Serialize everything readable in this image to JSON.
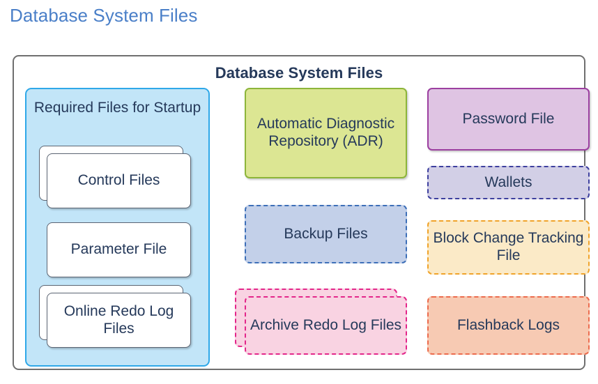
{
  "page": {
    "heading": "Database System Files",
    "heading_color": "#4a7fc8"
  },
  "diagram": {
    "title": "Database System Files",
    "title_color": "#25395a",
    "border_color": "#6f6f6f",
    "background": "#ffffff",
    "groups": [
      {
        "id": "required-files-for-startup",
        "label": "Required Files for Startup",
        "fill": "#c2e5f8",
        "border": "#2fa8e8",
        "border_style": "solid",
        "items": [
          {
            "id": "control-files",
            "label": "Control Files",
            "fill": "#ffffff",
            "border": "#5b6472",
            "border_style": "solid",
            "stacked": true
          },
          {
            "id": "parameter-file",
            "label": "Parameter File",
            "fill": "#ffffff",
            "border": "#5b6472",
            "border_style": "solid",
            "stacked": false
          },
          {
            "id": "online-redo-log-files",
            "label": "Online Redo Log Files",
            "fill": "#ffffff",
            "border": "#5b6472",
            "border_style": "solid",
            "stacked": true
          }
        ]
      }
    ],
    "middle_column": [
      {
        "id": "adr",
        "label": "Automatic Diagnostic Repository (ADR)",
        "fill": "#dce693",
        "border": "#8db53a",
        "border_style": "solid",
        "stacked": false
      },
      {
        "id": "backup-files",
        "label": "Backup Files",
        "fill": "#c3d0e9",
        "border": "#3d6fb8",
        "border_style": "dashed",
        "stacked": false
      },
      {
        "id": "archive-redo-log-files",
        "label": "Archive Redo Log Files",
        "fill": "#f9d3e2",
        "border": "#e3268a",
        "border_style": "dashed",
        "stacked": true
      }
    ],
    "right_column": [
      {
        "id": "password-file",
        "label": "Password File",
        "fill": "#dfc4e3",
        "border": "#9c3fa0",
        "border_style": "solid",
        "stacked": false
      },
      {
        "id": "wallets",
        "label": "Wallets",
        "fill": "#d2cfe6",
        "border": "#3d3f9e",
        "border_style": "dashed",
        "stacked": false
      },
      {
        "id": "block-change-tracking-file",
        "label": "Block Change Tracking File",
        "fill": "#fbeac7",
        "border": "#f0a32a",
        "border_style": "dashed",
        "stacked": false
      },
      {
        "id": "flashback-logs",
        "label": "Flashback Logs",
        "fill": "#f7cab3",
        "border": "#ec6b4d",
        "border_style": "dashed",
        "stacked": false
      }
    ]
  }
}
